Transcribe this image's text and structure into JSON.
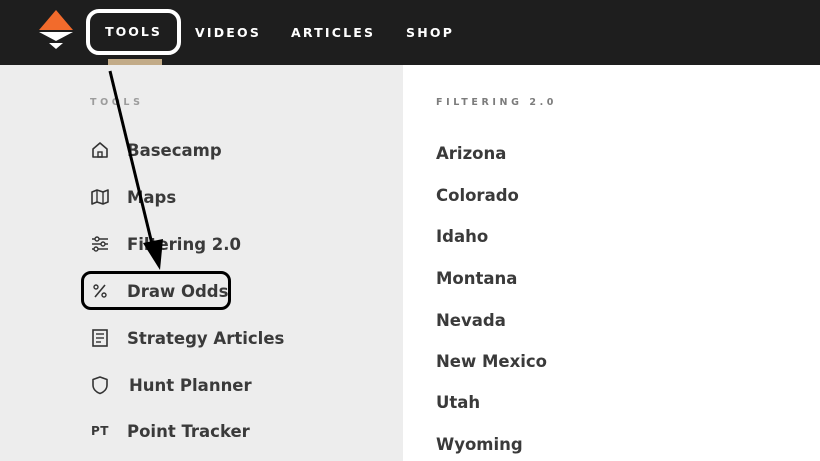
{
  "nav": {
    "items": [
      {
        "label": "TOOLS"
      },
      {
        "label": "VIDEOS"
      },
      {
        "label": "ARTICLES"
      },
      {
        "label": "SHOP"
      }
    ]
  },
  "brand": {
    "logo_icon": "gohunt-logo-icon",
    "accent": "#f26b2c",
    "nav_bg": "#1e1e1e",
    "underline": "#c2ab88"
  },
  "sidebar": {
    "heading": "TOOLS",
    "items": [
      {
        "label": "Basecamp",
        "icon": "home-icon"
      },
      {
        "label": "Maps",
        "icon": "map-icon"
      },
      {
        "label": "Filtering 2.0",
        "icon": "sliders-icon"
      },
      {
        "label": "Draw Odds",
        "icon": "percent-icon"
      },
      {
        "label": "Strategy Articles",
        "icon": "article-icon"
      },
      {
        "label": "Hunt Planner",
        "icon": "shield-icon"
      },
      {
        "label": "Point Tracker",
        "icon": "pt-icon",
        "icon_text": "PT"
      }
    ]
  },
  "panel": {
    "heading": "FILTERING 2.0",
    "states": [
      "Arizona",
      "Colorado",
      "Idaho",
      "Montana",
      "Nevada",
      "New Mexico",
      "Utah",
      "Wyoming"
    ]
  }
}
